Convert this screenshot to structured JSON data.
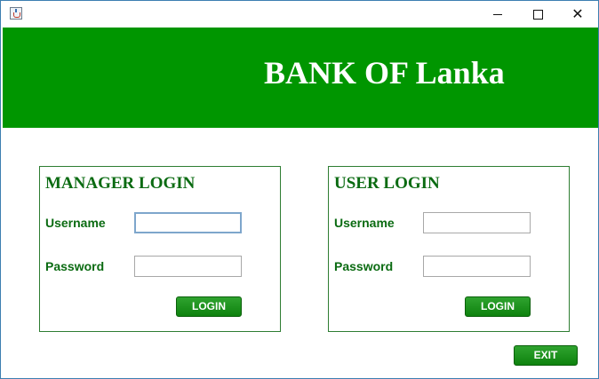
{
  "window": {
    "app_icon": "java-cup-icon",
    "controls": {
      "minimize": "minimize-icon",
      "maximize": "maximize-icon",
      "close_glyph": "✕"
    }
  },
  "banner": {
    "title": "BANK OF Lanka",
    "color": "#009600"
  },
  "manager_login": {
    "title": "MANAGER LOGIN",
    "username_label": "Username",
    "username_value": "",
    "password_label": "Password",
    "password_value": "",
    "login_label": "LOGIN"
  },
  "user_login": {
    "title": "USER LOGIN",
    "username_label": "Username",
    "username_value": "",
    "password_label": "Password",
    "password_value": "",
    "login_label": "LOGIN"
  },
  "exit_label": "EXIT",
  "colors": {
    "accent_green": "#009600",
    "label_green": "#0b6b12",
    "button_green": "#1a8f1a"
  }
}
